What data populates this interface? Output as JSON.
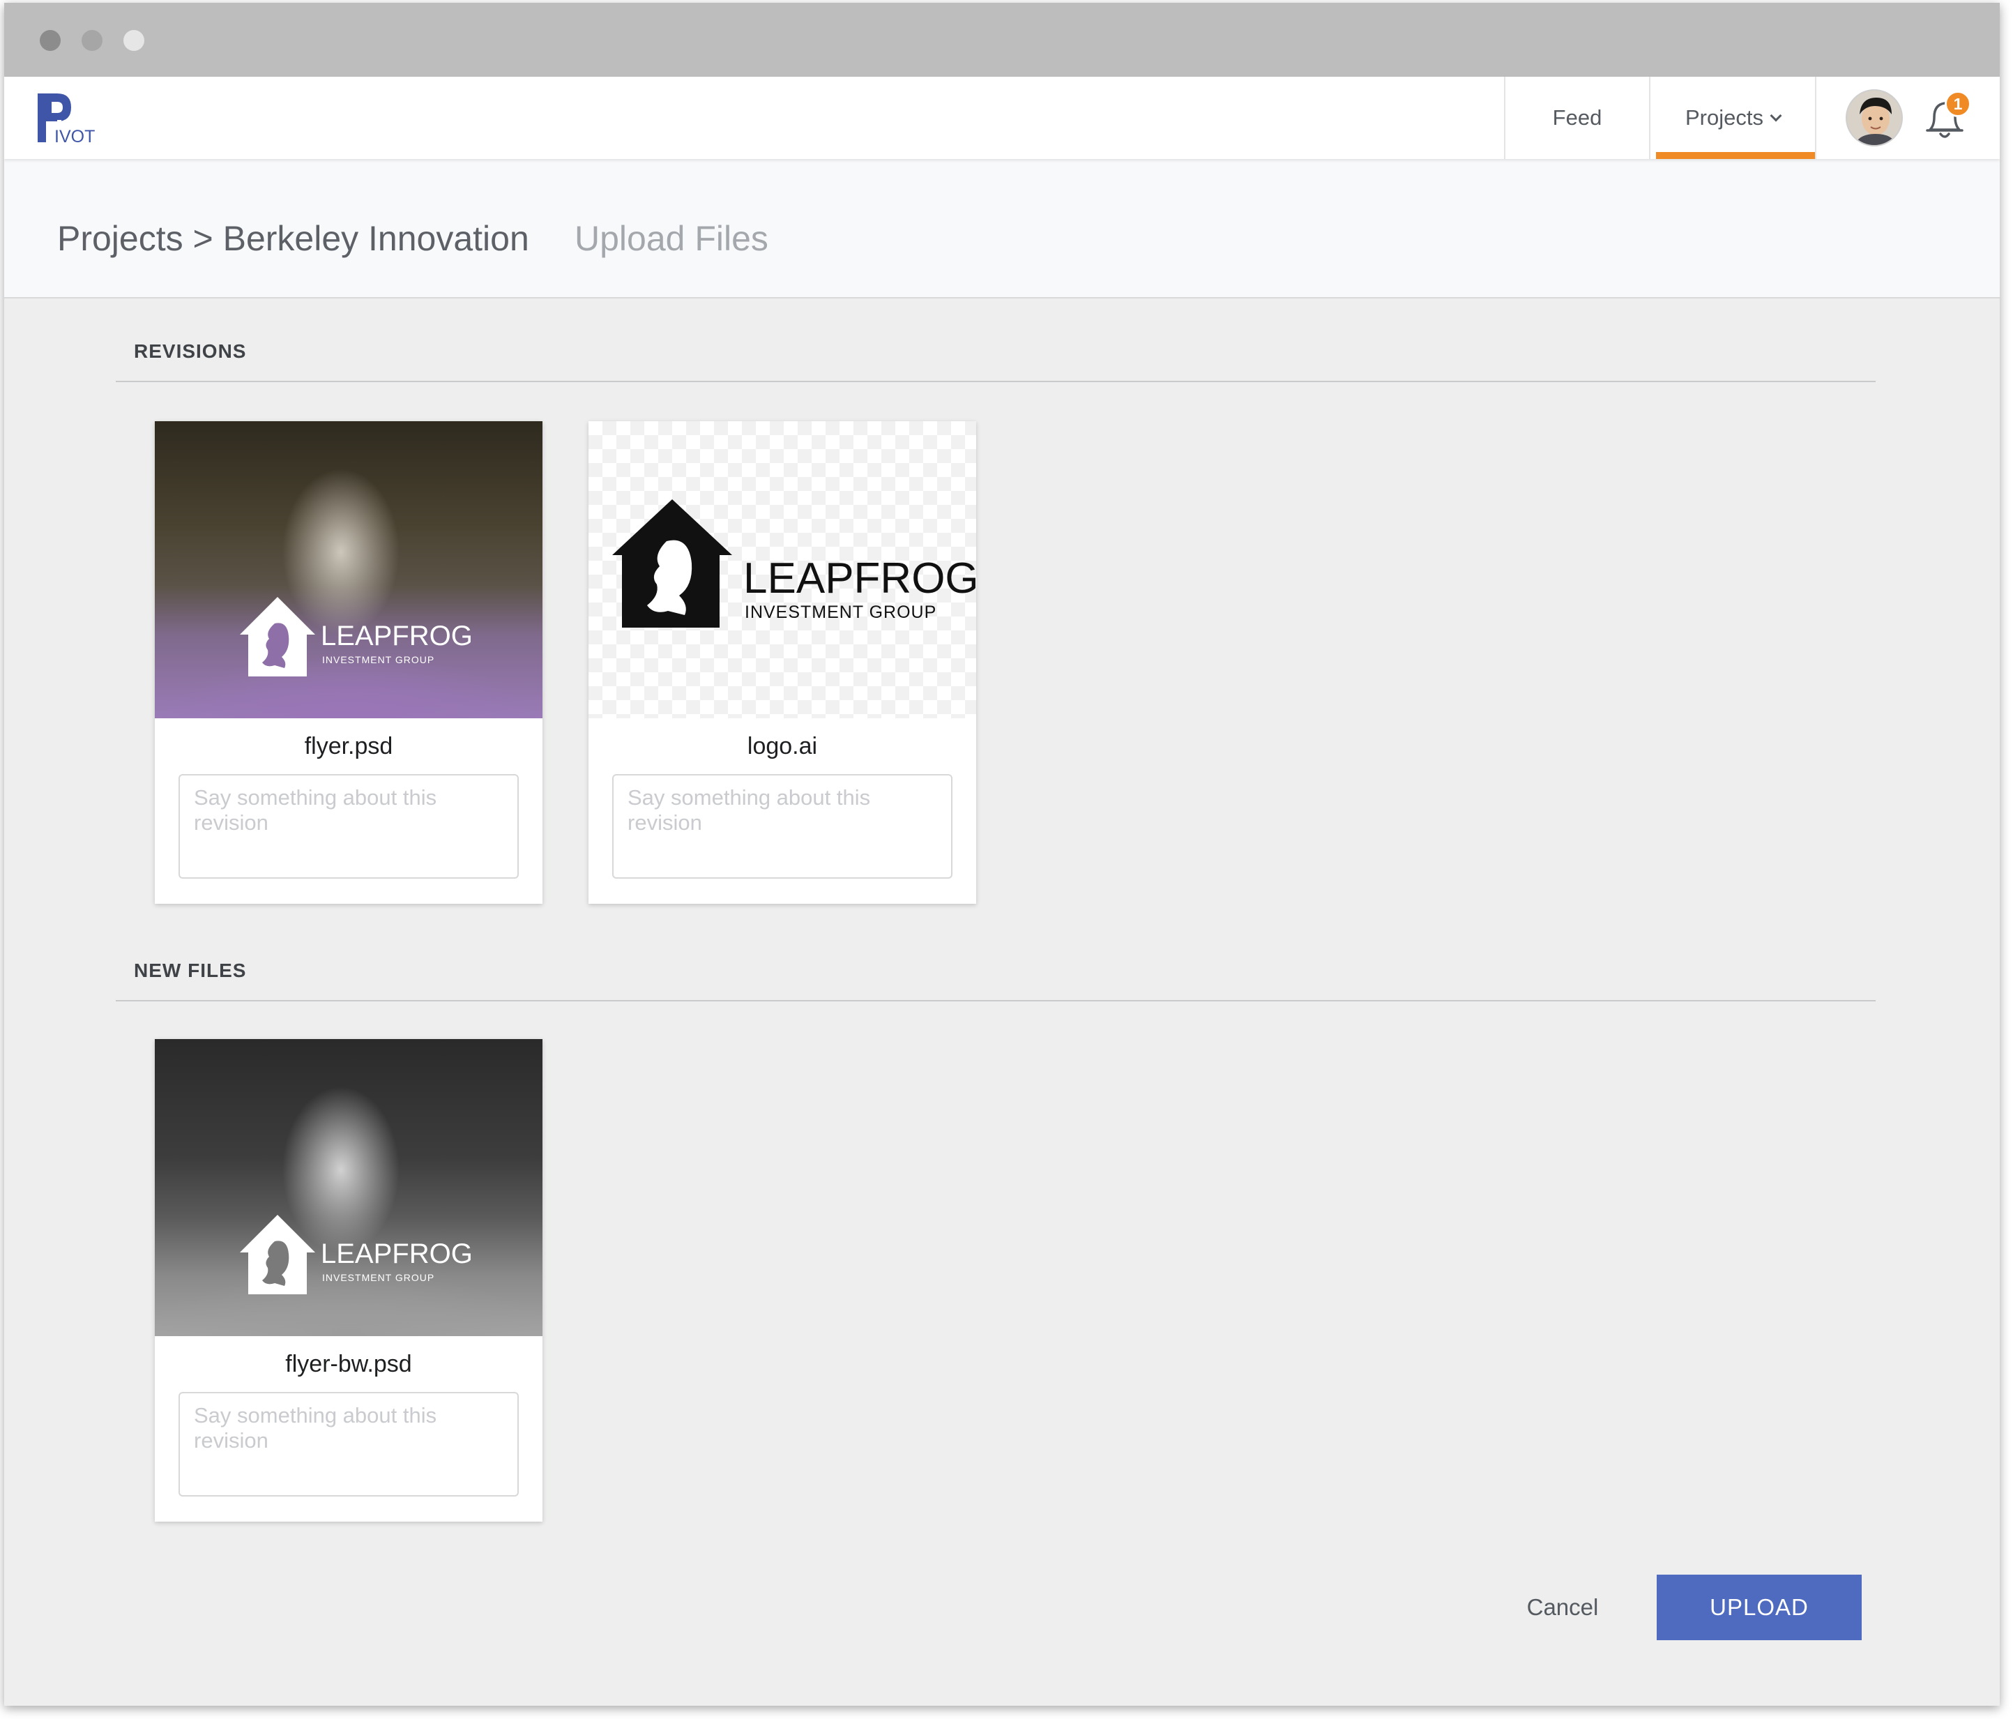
{
  "app": {
    "logo_text": "IVOT"
  },
  "nav": {
    "feed_label": "Feed",
    "projects_label": "Projects",
    "notification_count": "1",
    "active_tab_color": "#f08a24"
  },
  "breadcrumb": {
    "path": "Projects > Berkeley Innovation",
    "current": "Upload Files"
  },
  "sections": {
    "revisions_title": "REVISIONS",
    "new_files_title": "NEW FILES"
  },
  "revisions": [
    {
      "filename": "flyer.psd",
      "placeholder": "Say something about this revision",
      "brand": "LEAPFROG",
      "brand_sub": "INVESTMENT GROUP"
    },
    {
      "filename": "logo.ai",
      "placeholder": "Say something about this revision",
      "brand": "LEAPFROG",
      "brand_sub": "INVESTMENT GROUP"
    }
  ],
  "new_files": [
    {
      "filename": "flyer-bw.psd",
      "placeholder": "Say something about this revision",
      "brand": "LEAPFROG",
      "brand_sub": "INVESTMENT GROUP"
    }
  ],
  "actions": {
    "cancel_label": "Cancel",
    "upload_label": "UPLOAD",
    "upload_color": "#4f6bbf"
  }
}
